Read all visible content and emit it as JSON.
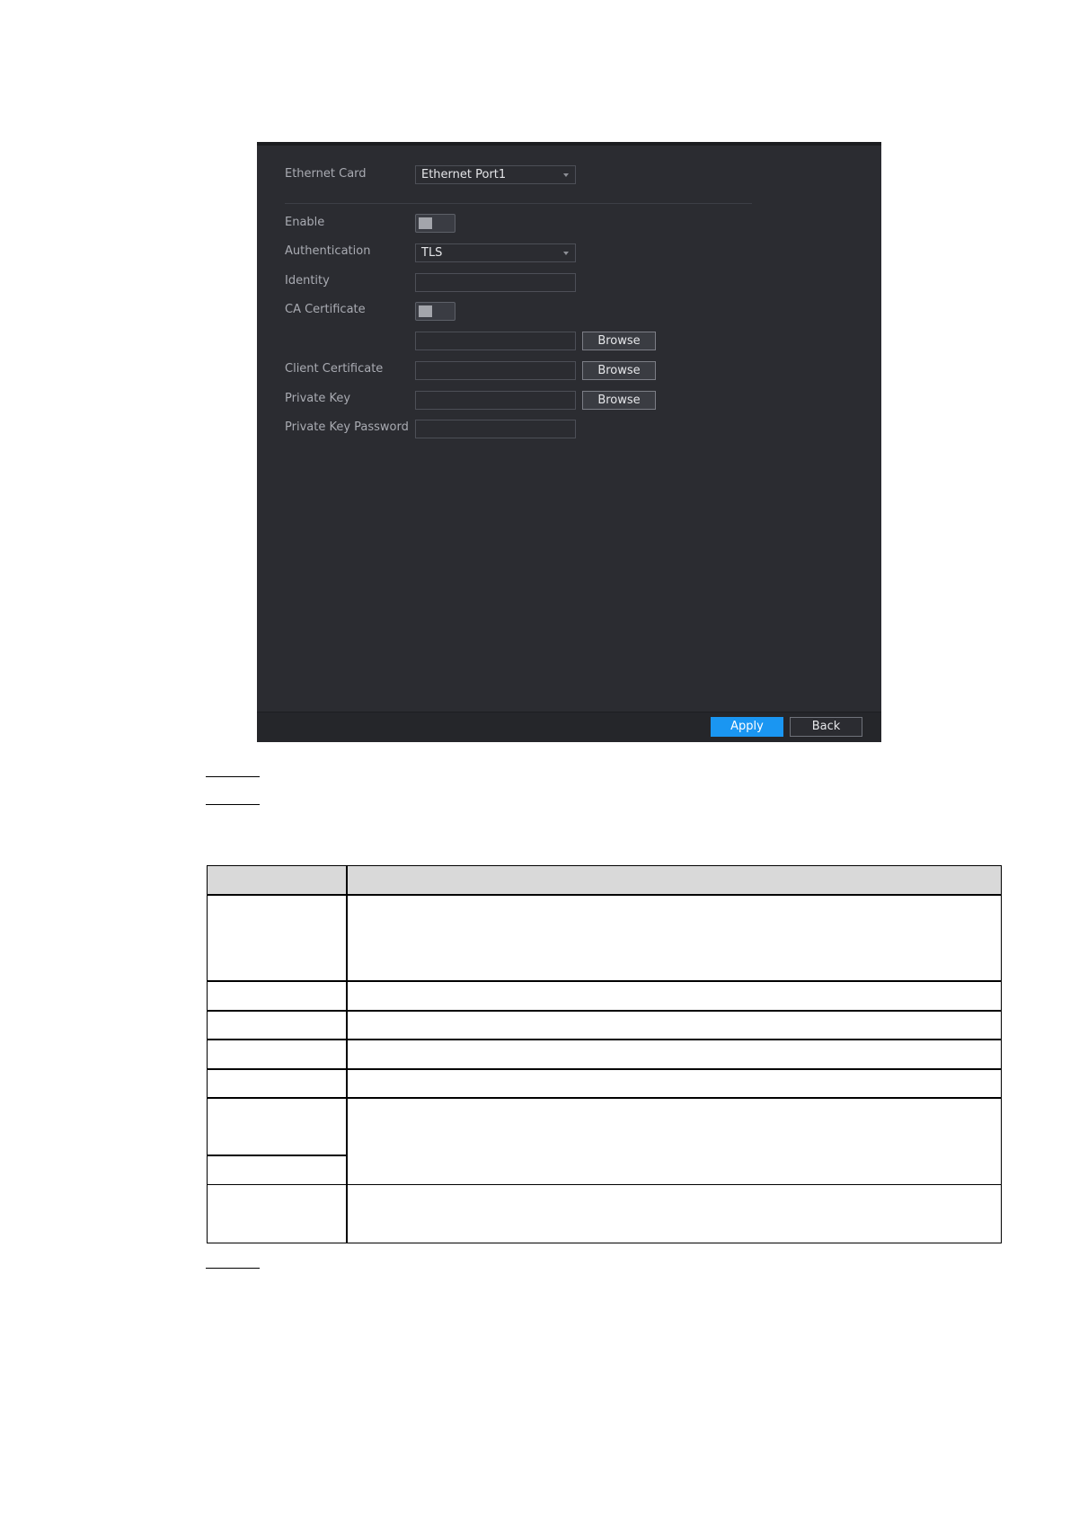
{
  "panel": {
    "ethernet_card_label": "Ethernet Card",
    "ethernet_card_value": "Ethernet Port1",
    "enable_label": "Enable",
    "authentication_label": "Authentication",
    "authentication_value": "TLS",
    "identity_label": "Identity",
    "identity_value": "",
    "ca_certificate_label": "CA Certificate",
    "ca_file_value": "",
    "client_certificate_label": "Client Certificate",
    "client_certificate_value": "",
    "private_key_label": "Private Key",
    "private_key_value": "",
    "private_key_password_label": "Private Key Password",
    "private_key_password_value": "",
    "browse_label": "Browse",
    "enable_on": false,
    "ca_certificate_on": false
  },
  "footer": {
    "apply_label": "Apply",
    "back_label": "Back"
  },
  "colors": {
    "panel_bg": "#2b2c31",
    "accent": "#1a96f2"
  }
}
